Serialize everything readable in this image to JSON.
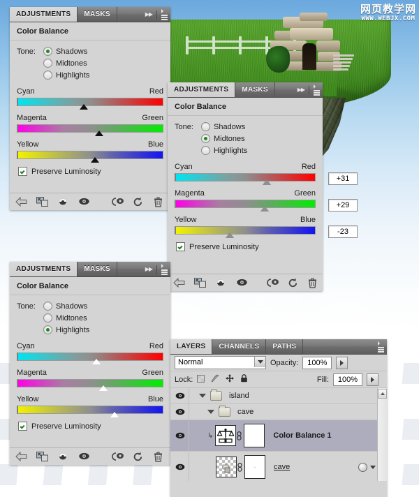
{
  "watermark": {
    "cn": "网页教学网",
    "url": "WWW.WEBJX.COM"
  },
  "panels": [
    {
      "id": "shadows",
      "tabs": [
        {
          "label": "ADJUSTMENTS",
          "active": true
        },
        {
          "label": "MASKS",
          "active": false
        }
      ],
      "title": "Color Balance",
      "tone_label": "Tone:",
      "tone_options": [
        "Shadows",
        "Midtones",
        "Highlights"
      ],
      "tone_selected": "Shadows",
      "sliders": [
        {
          "left": "Cyan",
          "right": "Red",
          "value": "-9",
          "pos_pct": 45.5
        },
        {
          "left": "Magenta",
          "right": "Green",
          "value": "+12",
          "pos_pct": 56.0
        },
        {
          "left": "Yellow",
          "right": "Blue",
          "value": "+6",
          "pos_pct": 53.0
        }
      ],
      "preserve_label": "Preserve Luminosity",
      "preserve_checked": true,
      "thumb_style": "dark"
    },
    {
      "id": "midtones",
      "tabs": [
        {
          "label": "ADJUSTMENTS",
          "active": true
        },
        {
          "label": "MASKS",
          "active": false
        }
      ],
      "title": "Color Balance",
      "tone_label": "Tone:",
      "tone_options": [
        "Shadows",
        "Midtones",
        "Highlights"
      ],
      "tone_selected": "Midtones",
      "sliders": [
        {
          "left": "Cyan",
          "right": "Red",
          "value": "+31",
          "pos_pct": 65.5
        },
        {
          "left": "Magenta",
          "right": "Green",
          "value": "+29",
          "pos_pct": 64.0
        },
        {
          "left": "Yellow",
          "right": "Blue",
          "value": "-23",
          "pos_pct": 38.5
        }
      ],
      "preserve_label": "Preserve Luminosity",
      "preserve_checked": true,
      "thumb_style": "mid"
    },
    {
      "id": "highlights",
      "tabs": [
        {
          "label": "ADJUSTMENTS",
          "active": true
        },
        {
          "label": "MASKS",
          "active": false
        }
      ],
      "title": "Color Balance",
      "tone_label": "Tone:",
      "tone_options": [
        "Shadows",
        "Midtones",
        "Highlights"
      ],
      "tone_selected": "Highlights",
      "sliders": [
        {
          "left": "Cyan",
          "right": "Red",
          "value": "+9",
          "pos_pct": 54.0
        },
        {
          "left": "Magenta",
          "right": "Green",
          "value": "+19",
          "pos_pct": 59.0
        },
        {
          "left": "Yellow",
          "right": "Blue",
          "value": "+33",
          "pos_pct": 66.5
        }
      ],
      "preserve_label": "Preserve Luminosity",
      "preserve_checked": true,
      "thumb_style": "light"
    }
  ],
  "footer_icons": [
    "return-arrow-icon",
    "clip-to-layer-icon",
    "preview-eye-filled-icon",
    "toggle-visibility-eye-icon",
    "view-previous-state-icon",
    "reset-icon",
    "delete-icon"
  ],
  "layers_panel": {
    "tabs": [
      {
        "label": "LAYERS",
        "active": true
      },
      {
        "label": "CHANNELS",
        "active": false
      },
      {
        "label": "PATHS",
        "active": false
      }
    ],
    "blend_mode": "Normal",
    "opacity_label": "Opacity:",
    "opacity_value": "100%",
    "lock_label": "Lock:",
    "lock_icons": [
      "lock-transparent-pixels-icon",
      "lock-image-pixels-icon",
      "lock-position-icon",
      "lock-all-icon"
    ],
    "fill_label": "Fill:",
    "fill_value": "100%",
    "rows": [
      {
        "name": "island",
        "type": "group",
        "depth": 0,
        "selected": false,
        "visible": true,
        "expanded": true
      },
      {
        "name": "cave",
        "type": "group",
        "depth": 1,
        "selected": false,
        "visible": true,
        "expanded": true
      },
      {
        "name": "Color Balance 1",
        "type": "adjustment",
        "depth": 2,
        "selected": true,
        "visible": true,
        "icon": "color-balance-scale-icon"
      },
      {
        "name": "cave",
        "type": "layer",
        "depth": 2,
        "selected": false,
        "visible": true,
        "icon": "layer-thumbnail"
      }
    ]
  },
  "colors": {
    "panel_bg": "#d4d4d4",
    "tab_active": "#d9d9d9",
    "selection": "#adadbd",
    "radio_on": "#1e8a1e",
    "check": "#108010"
  }
}
